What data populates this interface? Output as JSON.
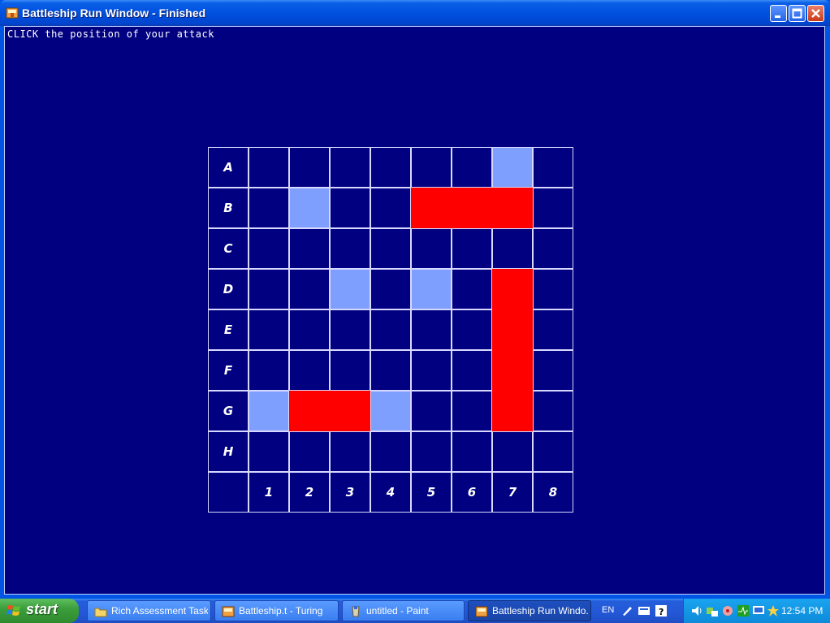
{
  "window": {
    "title": "Battleship Run Window - Finished",
    "prompt": "CLICK the position of your attack"
  },
  "board": {
    "row_labels": [
      "A",
      "B",
      "C",
      "D",
      "E",
      "F",
      "G",
      "H"
    ],
    "col_labels": [
      "1",
      "2",
      "3",
      "4",
      "5",
      "6",
      "7",
      "8"
    ],
    "cell_states": {
      "A": [
        "water",
        "water",
        "water",
        "water",
        "water",
        "water",
        "miss",
        "water"
      ],
      "B": [
        "water",
        "miss",
        "water",
        "water",
        "hit",
        "hit",
        "hit",
        "water"
      ],
      "C": [
        "water",
        "water",
        "water",
        "water",
        "water",
        "water",
        "water",
        "water"
      ],
      "D": [
        "water",
        "water",
        "miss",
        "water",
        "miss",
        "water",
        "hit",
        "water"
      ],
      "E": [
        "water",
        "water",
        "water",
        "water",
        "water",
        "water",
        "hit",
        "water"
      ],
      "F": [
        "water",
        "water",
        "water",
        "water",
        "water",
        "water",
        "hit",
        "water"
      ],
      "G": [
        "miss",
        "hit",
        "hit",
        "miss",
        "water",
        "water",
        "hit",
        "water"
      ],
      "H": [
        "water",
        "water",
        "water",
        "water",
        "water",
        "water",
        "water",
        "water"
      ]
    },
    "colors": {
      "water": "#000080",
      "miss": "#7f9fff",
      "hit": "#ff0000"
    }
  },
  "taskbar": {
    "start_label": "start",
    "tasks": [
      {
        "label": "Rich Assessment Task",
        "icon": "folder-icon"
      },
      {
        "label": "Battleship.t - Turing",
        "icon": "turing-icon"
      },
      {
        "label": "untitled - Paint",
        "icon": "paint-icon"
      },
      {
        "label": "Battleship Run Windo...",
        "icon": "turing-icon",
        "active": true
      }
    ],
    "language": "EN",
    "clock": "12:54 PM"
  }
}
